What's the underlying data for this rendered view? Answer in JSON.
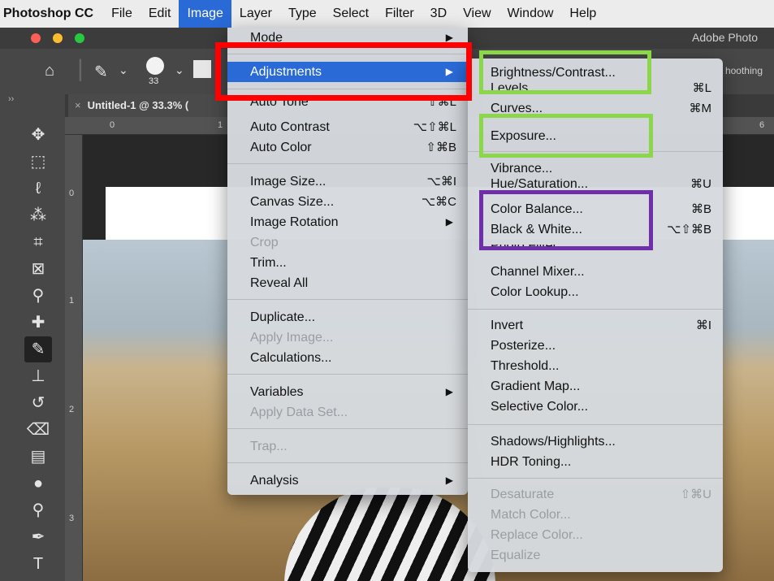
{
  "menubar": {
    "app_name": "Photoshop CC",
    "items": [
      "File",
      "Edit",
      "Image",
      "Layer",
      "Type",
      "Select",
      "Filter",
      "3D",
      "View",
      "Window",
      "Help"
    ],
    "active_item": "Image"
  },
  "window": {
    "title_fragment": "Adobe Photo",
    "doc_tab": {
      "close_glyph": "×",
      "title": "Untitled-1 @ 33.3% ("
    }
  },
  "options_bar": {
    "brush_size": "33",
    "extra_fragment": "hoothing"
  },
  "rulers": {
    "top": [
      "0",
      "1",
      "6"
    ],
    "left": [
      "0",
      "1",
      "2",
      "3"
    ]
  },
  "image_menu": {
    "rows": [
      {
        "label": "Mode",
        "arrow": "▶",
        "disabled": false
      },
      {
        "label": "Adjustments",
        "arrow": "▶",
        "highlighted": true
      },
      {
        "label": "Auto Tone",
        "shortcut": "⇧⌘L"
      },
      {
        "label": "Auto Contrast",
        "shortcut": "⌥⇧⌘L"
      },
      {
        "label": "Auto Color",
        "shortcut": "⇧⌘B"
      },
      {
        "label": "Image Size...",
        "shortcut": "⌥⌘I"
      },
      {
        "label": "Canvas Size...",
        "shortcut": "⌥⌘C"
      },
      {
        "label": "Image Rotation",
        "arrow": "▶"
      },
      {
        "label": "Crop",
        "disabled": true
      },
      {
        "label": "Trim..."
      },
      {
        "label": "Reveal All"
      },
      {
        "label": "Duplicate..."
      },
      {
        "label": "Apply Image...",
        "disabled": true
      },
      {
        "label": "Calculations..."
      },
      {
        "label": "Variables",
        "arrow": "▶"
      },
      {
        "label": "Apply Data Set...",
        "disabled": true
      },
      {
        "label": "Trap...",
        "disabled": true
      },
      {
        "label": "Analysis",
        "arrow": "▶"
      }
    ]
  },
  "adjustments_menu": {
    "rows": [
      {
        "label": "Brightness/Contrast..."
      },
      {
        "label": "Levels...",
        "shortcut": "⌘L"
      },
      {
        "label": "Curves...",
        "shortcut": "⌘M"
      },
      {
        "label": "Exposure..."
      },
      {
        "label": "Vibrance..."
      },
      {
        "label": "Hue/Saturation...",
        "shortcut": "⌘U"
      },
      {
        "label": "Color Balance...",
        "shortcut": "⌘B"
      },
      {
        "label": "Black & White...",
        "shortcut": "⌥⇧⌘B"
      },
      {
        "label": "Photo Filter..."
      },
      {
        "label": "Channel Mixer..."
      },
      {
        "label": "Color Lookup..."
      },
      {
        "label": "Invert",
        "shortcut": "⌘I"
      },
      {
        "label": "Posterize..."
      },
      {
        "label": "Threshold..."
      },
      {
        "label": "Gradient Map..."
      },
      {
        "label": "Selective Color..."
      },
      {
        "label": "Shadows/Highlights..."
      },
      {
        "label": "HDR Toning..."
      },
      {
        "label": "Desaturate",
        "shortcut": "⇧⌘U",
        "disabled": true
      },
      {
        "label": "Match Color...",
        "disabled": true
      },
      {
        "label": "Replace Color...",
        "disabled": true
      },
      {
        "label": "Equalize",
        "disabled": true
      }
    ]
  },
  "colors": {
    "menu_highlight": "#2a6ad7",
    "annotation_red": "#ff0000",
    "annotation_green": "#8cd64b",
    "annotation_purple": "#6e2fa8",
    "traffic_red": "#fe5f57",
    "traffic_yellow": "#febc2e",
    "traffic_green": "#28c840"
  },
  "tool_icons": [
    "move-icon",
    "marquee-icon",
    "lasso-icon",
    "magic-wand-icon",
    "crop-icon",
    "frame-icon",
    "eyedropper-icon",
    "healing-brush-icon",
    "brush-icon",
    "clone-stamp-icon",
    "history-brush-icon",
    "eraser-icon",
    "gradient-icon",
    "blur-icon",
    "dodge-icon",
    "pen-icon",
    "type-icon"
  ]
}
